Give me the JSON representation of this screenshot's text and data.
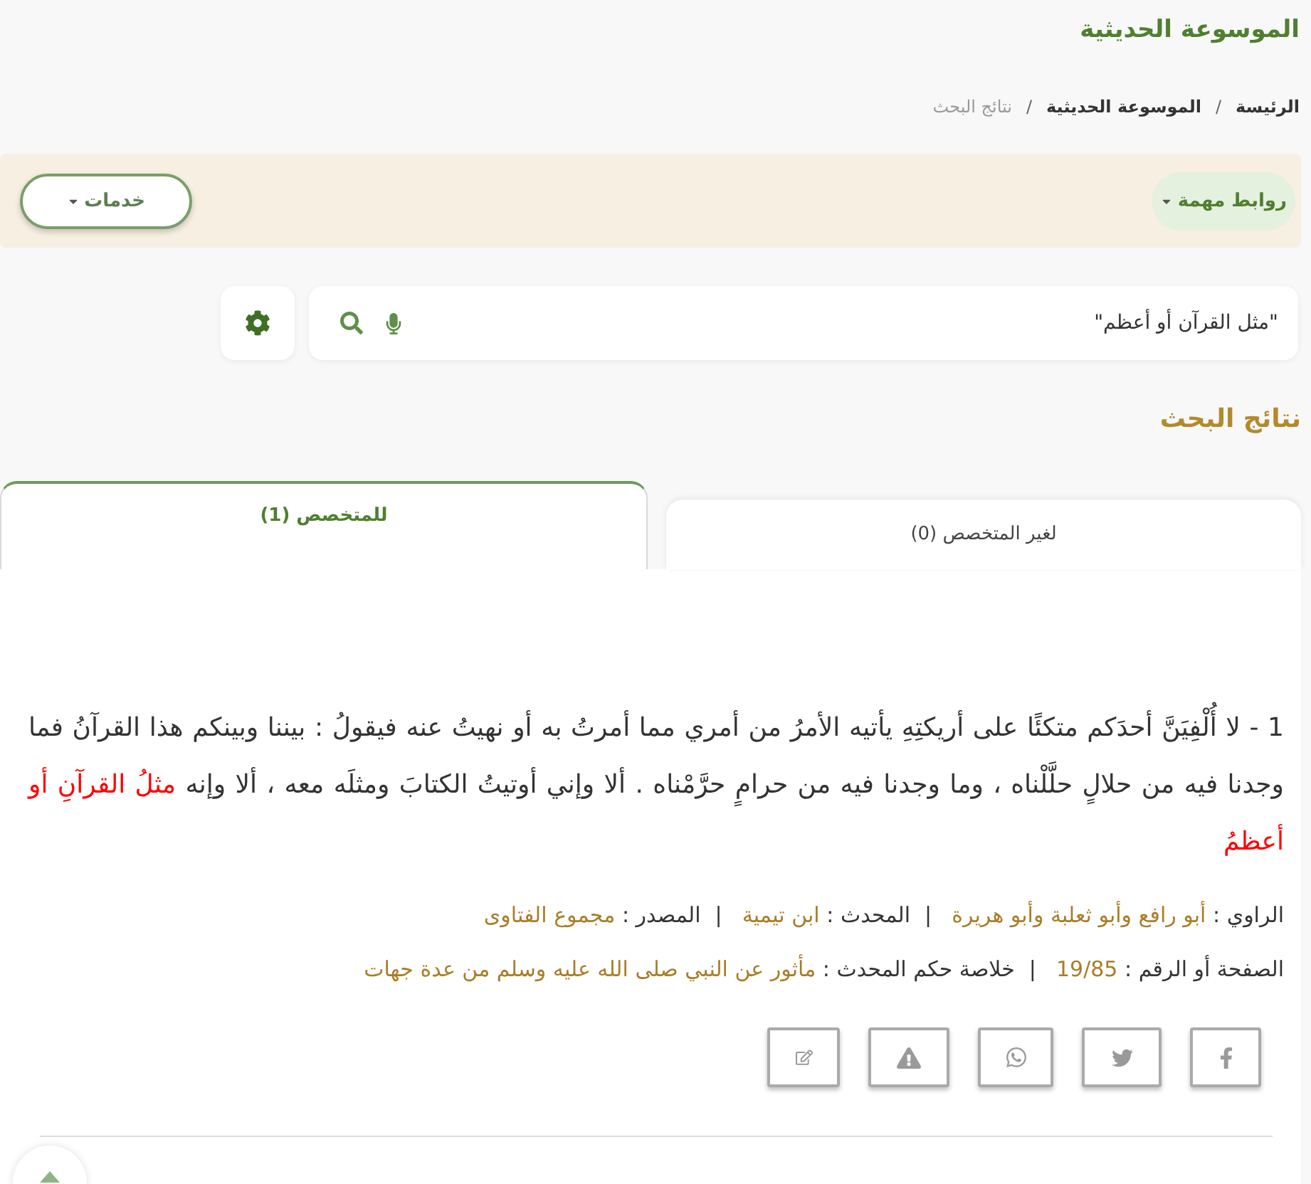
{
  "header": {
    "title": "الموسوعة الحديثية"
  },
  "breadcrumb": [
    {
      "label": "الرئيسة",
      "current": false
    },
    {
      "separator": "/",
      "label": "الموسوعة الحديثية",
      "current": false
    },
    {
      "separator": "/",
      "label": "نتائج البحث",
      "current": true
    }
  ],
  "links_bar": {
    "important_links": {
      "label": "روابط مهمة"
    },
    "services": {
      "label": "خدمات"
    }
  },
  "search": {
    "value": "\"مثل القرآن أو أعظم\""
  },
  "results": {
    "heading": "نتائج البحث",
    "tabs": [
      {
        "label": "لغير المتخصص (0)",
        "selected": false
      },
      {
        "label": "للمتخصص (1)",
        "selected": true
      }
    ]
  },
  "hadiths": [
    {
      "segments": [
        {
          "text": "1 - لا أُلْفِيَنَّ أحدَكم متكئًا على أريكتِهِ يأتيه الأمرُ من أمري مما أمرتُ به أو نهيتُ عنه فيقولُ : بيننا وبينكم هذا القرآنُ فما وجدنا فيه من حلالٍ حلَّلْناه ، وما وجدنا فيه من حرامٍ حرَّمْناه . ألا وإني أوتيتُ الكتابَ ومثلَه معه ، ألا وإنه ",
          "highlighted": false
        },
        {
          "text": "مثلُ القرآنِ أو أعظمُ",
          "highlighted": true
        }
      ],
      "details": [
        [
          {
            "label": "الراوي :",
            "value": "أبو رافع وأبو ثعلبة وأبو هريرة"
          },
          {
            "separator": "|",
            "label": "المحدث :",
            "value": "ابن تيمية"
          },
          {
            "separator": "|",
            "label": "المصدر :",
            "value": "مجموع الفتاوى"
          }
        ],
        [
          {
            "label": "الصفحة أو الرقم :",
            "value": "19/85"
          },
          {
            "separator": "|",
            "label": "خلاصة حكم المحدث :",
            "value": "مأثور عن النبي صلى الله عليه وسلم من عدة جهات"
          }
        ]
      ]
    }
  ]
}
